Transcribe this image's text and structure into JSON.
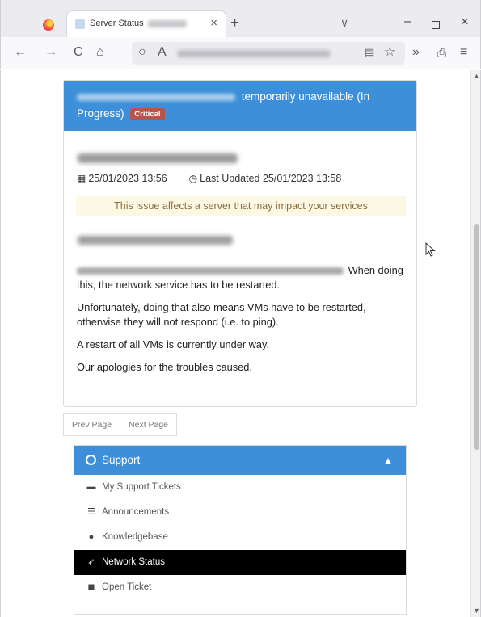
{
  "browser": {
    "tab_title": "Server Status",
    "tab_close": "×",
    "new_tab": "+",
    "list_tabs": "∨",
    "minimize": "–",
    "close": "×",
    "nav_back": "←",
    "nav_forward": "→",
    "reload": "C",
    "home": "⌂",
    "tracking": "○",
    "lock": "A",
    "reader": "▤",
    "bookmark": "☆",
    "overflow": "»",
    "extensions": "⎙",
    "menu": "≡"
  },
  "incident": {
    "headline_suffix": "temporarily unavailable (In Progress)",
    "severity_badge": "Critical",
    "date_created": "25/01/2023 13:56",
    "last_updated_label": "Last Updated",
    "last_updated": "25/01/2023 13:58",
    "notice": "This issue affects a server that may impact your services",
    "paragraph1_suffix": "When doing this, the network service has to be restarted.",
    "paragraph2": "Unfortunately, doing that also means VMs have to be restarted, otherwise they will not respond (i.e. to ping).",
    "paragraph3": "A restart of all VMs is currently under way.",
    "paragraph4": "Our apologies for the troubles caused."
  },
  "pager": {
    "prev": "Prev Page",
    "next": "Next Page"
  },
  "support": {
    "title": "Support",
    "items": [
      {
        "label": "My Support Tickets",
        "icon": "ticket-icon"
      },
      {
        "label": "Announcements",
        "icon": "list-icon"
      },
      {
        "label": "Knowledgebase",
        "icon": "info-icon"
      },
      {
        "label": "Network Status",
        "icon": "rocket-icon",
        "active": true
      },
      {
        "label": "Open Ticket",
        "icon": "comments-icon"
      }
    ]
  },
  "colors": {
    "accent": "#3c8fd8",
    "badge": "#b8534e",
    "notice_bg": "#fcf8e3",
    "notice_text": "#8a6d3b"
  }
}
